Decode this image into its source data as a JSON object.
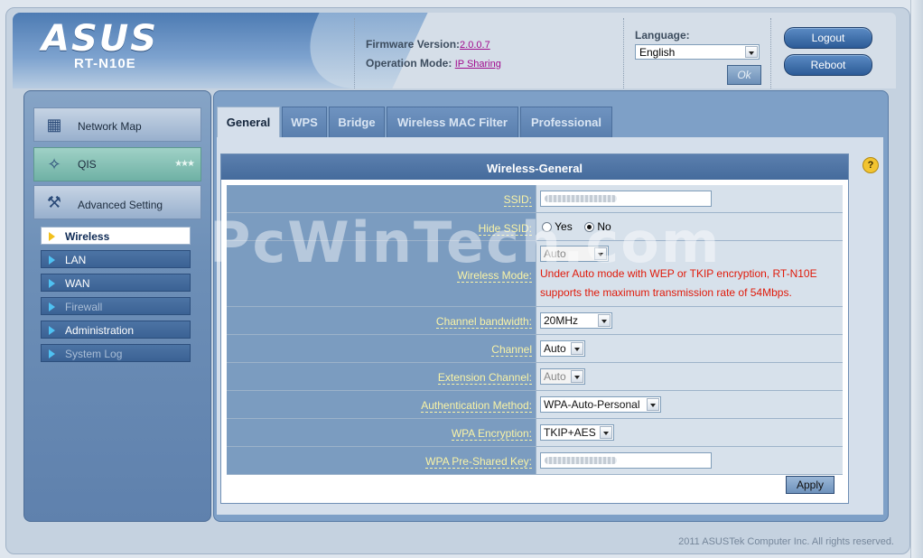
{
  "header": {
    "brand": "ASUS",
    "model": "RT-N10E",
    "firmware_label": "Firmware Version:",
    "firmware_value": "2.0.0.7",
    "mode_label": "Operation Mode:",
    "mode_value": "IP Sharing",
    "language_label": "Language:",
    "language_value": "English",
    "ok_label": "Ok",
    "logout_label": "Logout",
    "reboot_label": "Reboot"
  },
  "sidebar": {
    "network_map": "Network Map",
    "qis": "QIS",
    "advanced": "Advanced Setting",
    "items": [
      {
        "label": "Wireless"
      },
      {
        "label": "LAN"
      },
      {
        "label": "WAN"
      },
      {
        "label": "Firewall"
      },
      {
        "label": "Administration"
      },
      {
        "label": "System Log"
      }
    ]
  },
  "tabs": [
    "General",
    "WPS",
    "Bridge",
    "Wireless MAC Filter",
    "Professional"
  ],
  "panel": {
    "title": "Wireless-General",
    "ssid_label": "SSID:",
    "hide_ssid_label": "Hide SSID:",
    "hide_yes": "Yes",
    "hide_no": "No",
    "wireless_mode_label": "Wireless Mode:",
    "wireless_mode_value": "Auto",
    "wireless_mode_warning_1": "Under Auto mode with WEP or TKIP encryption, RT-N10E",
    "wireless_mode_warning_2": "supports the maximum transmission rate of 54Mbps.",
    "channel_bw_label": "Channel bandwidth:",
    "channel_bw_value": "20MHz",
    "channel_label": "Channel",
    "channel_value": "Auto",
    "ext_channel_label": "Extension Channel:",
    "ext_channel_value": "Auto",
    "auth_label": "Authentication Method:",
    "auth_value": "WPA-Auto-Personal",
    "wpa_enc_label": "WPA Encryption:",
    "wpa_enc_value": "TKIP+AES",
    "psk_label": "WPA Pre-Shared Key:",
    "apply_label": "Apply"
  },
  "watermark": "PcWinTech.com",
  "footer": "2011 ASUSTek Computer Inc. All rights reserved.",
  "colors": {
    "sidebar_active": "#ffffff",
    "warning_text": "#e01a0a",
    "label_text": "#f9f3a6"
  }
}
